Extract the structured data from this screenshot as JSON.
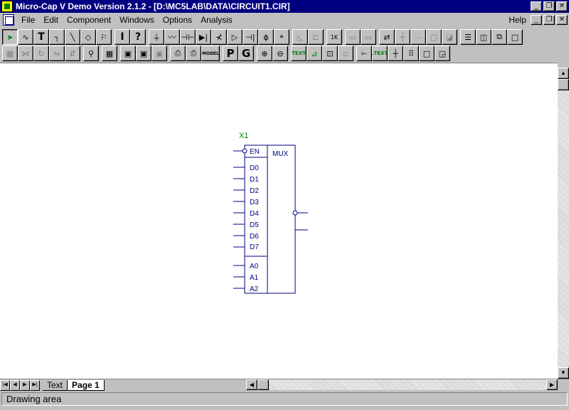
{
  "window": {
    "title": "Micro-Cap V Demo Version 2.1.2 - [D:\\MC5LAB\\DATA\\CIRCUIT1.CIR]"
  },
  "menu": {
    "items": [
      {
        "label": "File"
      },
      {
        "label": "Edit"
      },
      {
        "label": "Component"
      },
      {
        "label": "Windows"
      },
      {
        "label": "Options"
      },
      {
        "label": "Analysis"
      }
    ],
    "help": "Help"
  },
  "toolbar1": [
    "select-arrow-icon",
    "wire-icon",
    "text-icon",
    "wire-ortho-icon",
    "line-icon",
    "shapes-icon",
    "flag-icon",
    "info-icon",
    "help-icon",
    "ground-icon",
    "resistor-icon",
    "capacitor-icon",
    "diode-icon",
    "transistor-icon",
    "buffer-icon",
    "battery-icon",
    "source-icon",
    "node-icon",
    "mirror-icon",
    "flip-icon",
    "unit-icon",
    "box1-icon",
    "box2-icon",
    "exchange-icon",
    "cross-icon",
    "grid-dots-icon",
    "box3-icon",
    "box4-icon",
    "tile-h-icon",
    "tile-v-icon",
    "cascade-icon",
    "maximize-icon"
  ],
  "toolbar2": {
    "text_button": "TEXT",
    "text2_button": ".TEXT",
    "model_button": "MODEL",
    "p_button": "P",
    "g_button": "G"
  },
  "schematic": {
    "part_name": "X1",
    "block_label": "MUX",
    "enable_pin": "EN",
    "data_pins": [
      "D0",
      "D1",
      "D2",
      "D3",
      "D4",
      "D5",
      "D6",
      "D7"
    ],
    "select_pins": [
      "A0",
      "A1",
      "A2"
    ],
    "accent_color": "#000080",
    "label_color": "#008000"
  },
  "tabs": [
    {
      "label": "Text"
    },
    {
      "label": "Page 1"
    }
  ],
  "status": {
    "text": "Drawing area"
  }
}
